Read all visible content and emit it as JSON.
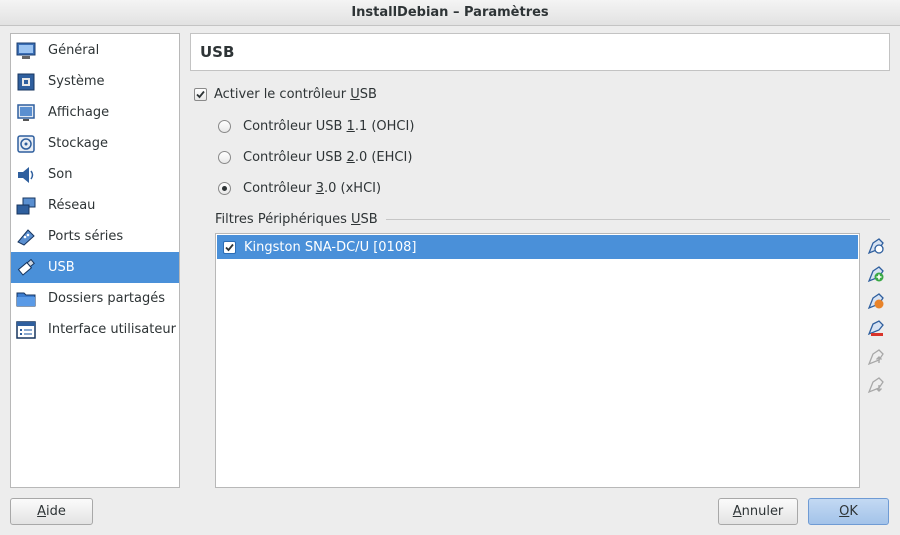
{
  "window": {
    "title": "InstallDebian – Paramètres"
  },
  "sidebar": {
    "items": [
      {
        "label": "Général",
        "icon": "general-icon",
        "selected": false
      },
      {
        "label": "Système",
        "icon": "system-icon",
        "selected": false
      },
      {
        "label": "Affichage",
        "icon": "display-icon",
        "selected": false
      },
      {
        "label": "Stockage",
        "icon": "storage-icon",
        "selected": false
      },
      {
        "label": "Son",
        "icon": "sound-icon",
        "selected": false
      },
      {
        "label": "Réseau",
        "icon": "network-icon",
        "selected": false
      },
      {
        "label": "Ports séries",
        "icon": "serial-ports-icon",
        "selected": false
      },
      {
        "label": "USB",
        "icon": "usb-icon",
        "selected": true
      },
      {
        "label": "Dossiers partagés",
        "icon": "shared-folders-icon",
        "selected": false
      },
      {
        "label": "Interface utilisateur",
        "icon": "user-interface-icon",
        "selected": false
      }
    ]
  },
  "main": {
    "section_title": "USB",
    "enable_controller": {
      "label_pre": "Activer le contrôleur ",
      "label_mnemonic": "U",
      "label_post": "SB",
      "checked": true
    },
    "controllers": [
      {
        "label_pre": "Contrôleur USB ",
        "label_mnemonic": "1",
        "label_post": ".1 (OHCI)",
        "selected": false
      },
      {
        "label_pre": "Contrôleur USB ",
        "label_mnemonic": "2",
        "label_post": ".0 (EHCI)",
        "selected": false
      },
      {
        "label_pre": "Contrôleur ",
        "label_mnemonic": "3",
        "label_post": ".0 (xHCI)",
        "selected": true
      }
    ],
    "filters_group": {
      "label_pre": "Filtres Périphériques ",
      "label_mnemonic": "U",
      "label_post": "SB"
    },
    "filters": [
      {
        "label": "Kingston SNA-DC/U [0108]",
        "checked": true
      }
    ],
    "toolbar": [
      {
        "icon": "add-empty-filter-icon",
        "enabled": true
      },
      {
        "icon": "add-filter-from-device-icon",
        "enabled": true
      },
      {
        "icon": "edit-filter-icon",
        "enabled": true
      },
      {
        "icon": "remove-filter-icon",
        "enabled": true
      },
      {
        "icon": "move-filter-up-icon",
        "enabled": false
      },
      {
        "icon": "move-filter-down-icon",
        "enabled": false
      }
    ]
  },
  "buttons": {
    "help": {
      "mnemonic": "A",
      "rest": "ide"
    },
    "cancel": {
      "mnemonic": "A",
      "rest": "nnuler"
    },
    "ok": {
      "mnemonic": "O",
      "rest": "K"
    }
  },
  "colors": {
    "selection": "#4a90d9",
    "window_bg": "#ededed"
  }
}
